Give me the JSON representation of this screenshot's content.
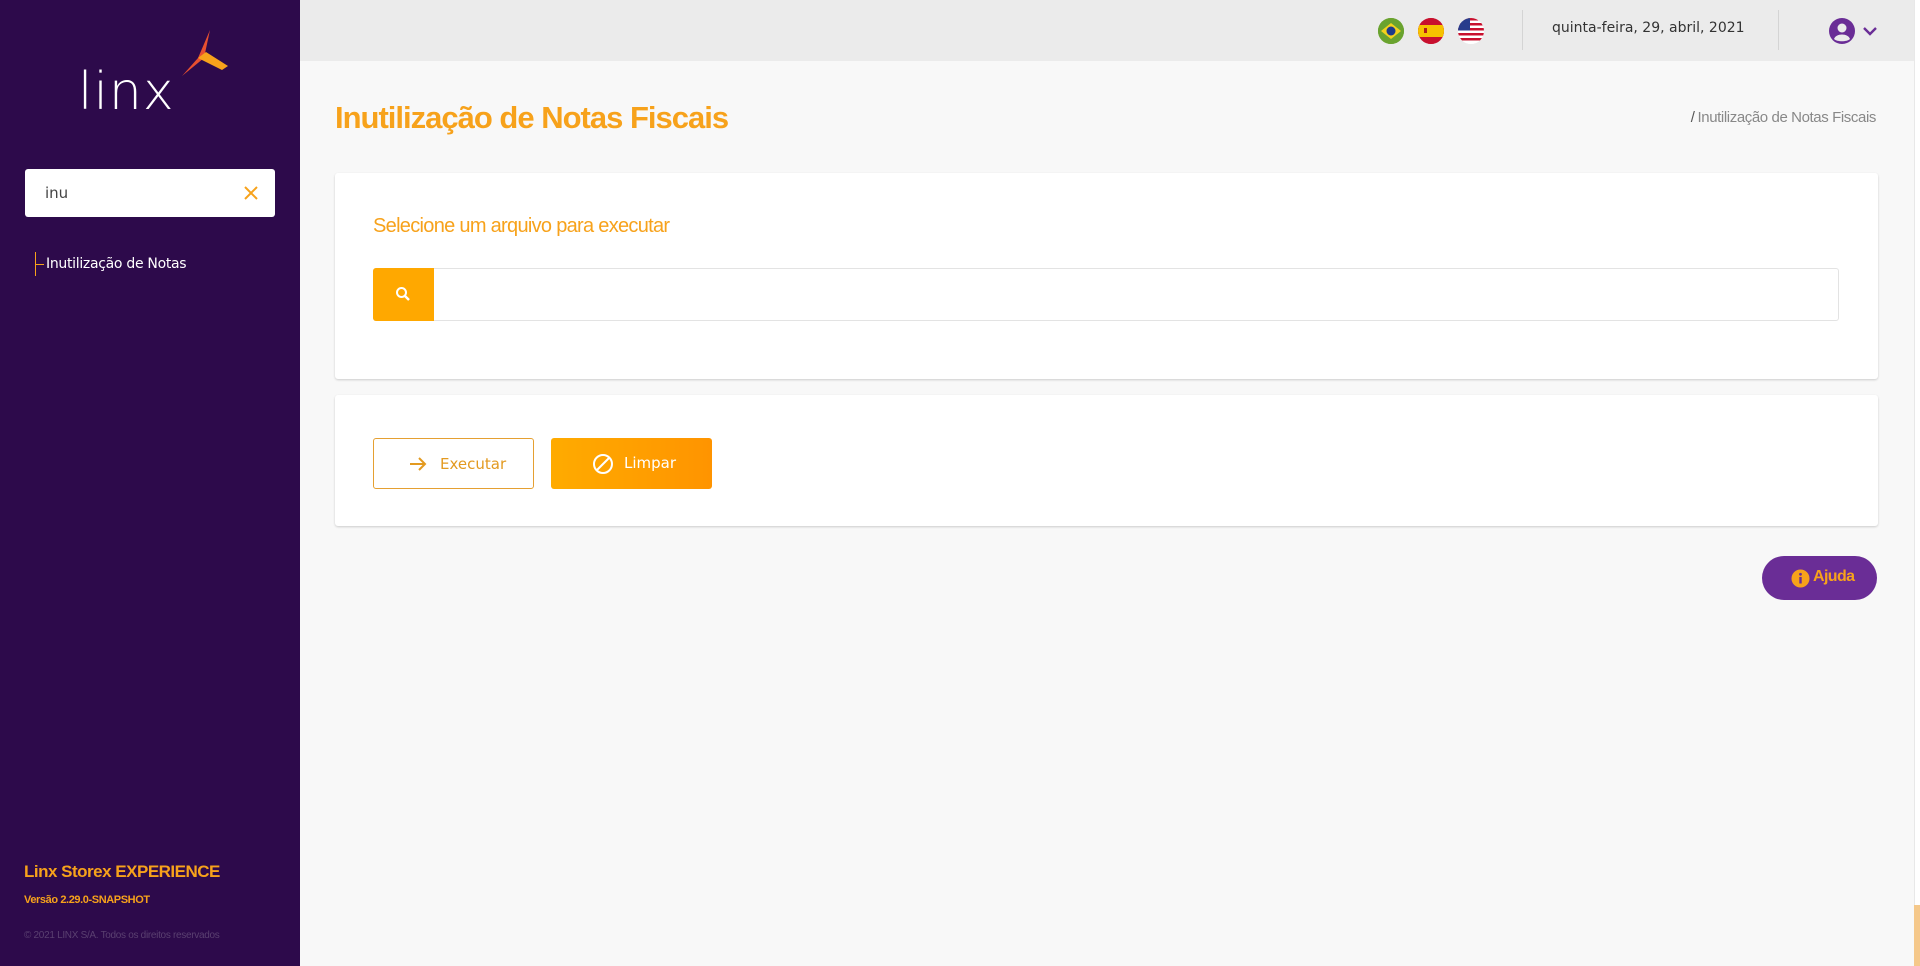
{
  "sidebar": {
    "logo_text": "linx",
    "search": {
      "value": "inu",
      "placeholder": ""
    },
    "menu_items": [
      {
        "label": "Inutilização de Notas"
      }
    ],
    "app_name": "Linx Storex EXPERIENCE",
    "version": "Versão 2.29.0-SNAPSHOT",
    "copyright": "© 2021 LINX S/A. Todos os direitos reservados"
  },
  "topbar": {
    "languages": [
      "pt-BR",
      "es",
      "en-US"
    ],
    "date": "quinta-feira, 29, abril, 2021"
  },
  "main": {
    "title": "Inutilização de Notas Fiscais",
    "breadcrumb": {
      "separator": "/",
      "current": "Inutilização de Notas Fiscais"
    },
    "file_card": {
      "title": "Selecione um arquivo para executar",
      "file_value": ""
    },
    "actions": {
      "execute_label": "Executar",
      "clear_label": "Limpar"
    },
    "help_label": "Ajuda"
  },
  "colors": {
    "sidebar_bg": "#2d0a4b",
    "accent_orange": "#f7a21b",
    "help_purple": "#6a2d96"
  },
  "icons": {
    "search_clear": "close-icon",
    "file_search": "search-icon",
    "execute": "arrow-right-icon",
    "clear": "ban-icon",
    "help": "info-icon",
    "user": "user-circle-icon",
    "user_menu": "chevron-down-icon"
  }
}
